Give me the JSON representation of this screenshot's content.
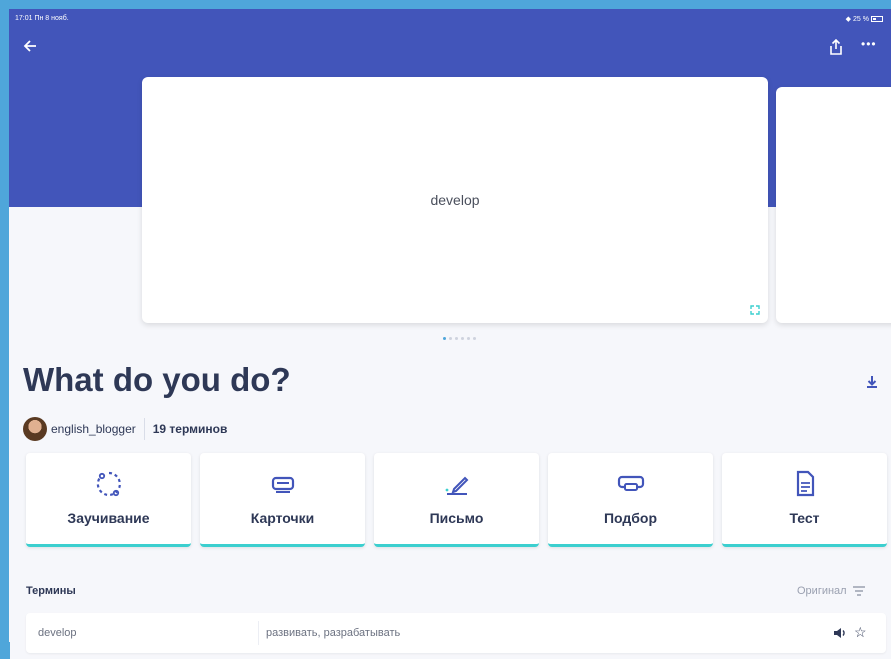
{
  "colors": {
    "brand": "#4255ba",
    "accent": "#3ccfcf",
    "frame": "#4fa6da",
    "text": "#2e3856"
  },
  "statusbar": {
    "time": "17:01  Пн 8 нояб.",
    "battery": "25 %"
  },
  "header": {
    "back_icon": "arrow-left-icon",
    "share_icon": "share-icon",
    "more_icon": "more-horizontal-icon"
  },
  "flashcard": {
    "term": "develop",
    "expand_icon": "expand-icon"
  },
  "carousel": {
    "pages": 6,
    "active": 0
  },
  "set": {
    "title": "What do you do?",
    "author": "english_blogger",
    "term_count": "19 терминов",
    "download_icon": "download-icon"
  },
  "modes": [
    {
      "label": "Заучивание",
      "icon": "learn-cycle-icon"
    },
    {
      "label": "Карточки",
      "icon": "cards-icon"
    },
    {
      "label": "Письмо",
      "icon": "write-pen-icon"
    },
    {
      "label": "Подбор",
      "icon": "match-icon"
    },
    {
      "label": "Тест",
      "icon": "test-doc-icon"
    }
  ],
  "terms": {
    "header": "Термины",
    "sort_label": "Оригинал",
    "sort_icon": "filter-icon",
    "rows": [
      {
        "term": "develop",
        "definition": "развивать, разрабатывать",
        "audio_icon": "speaker-icon",
        "star_icon": "star-icon"
      }
    ]
  }
}
